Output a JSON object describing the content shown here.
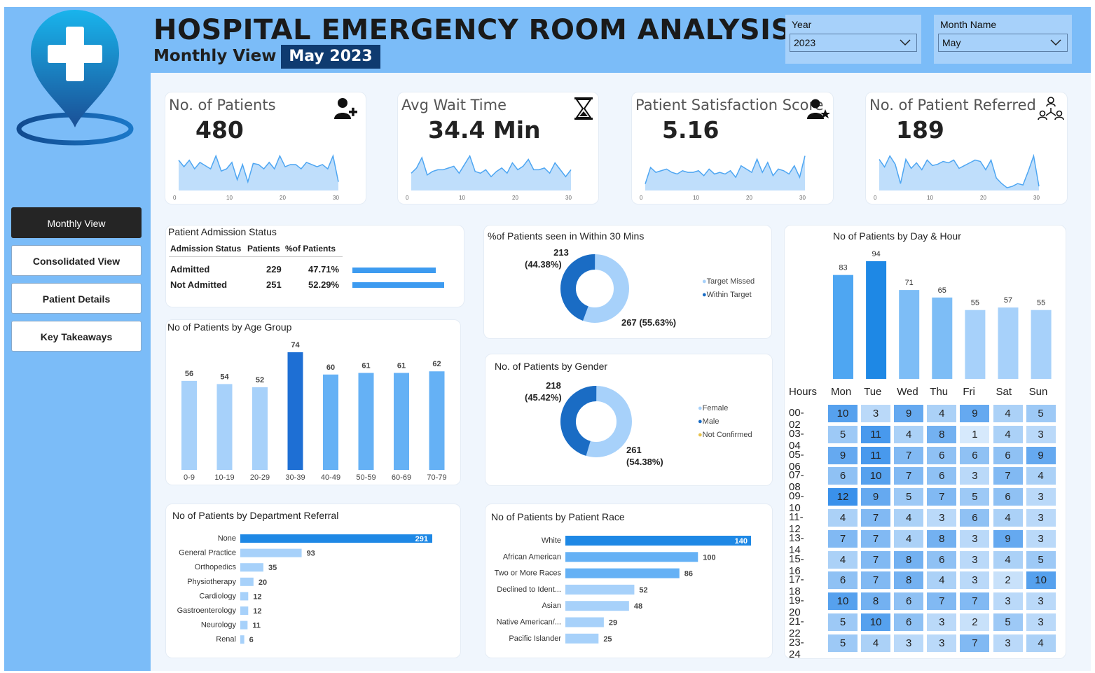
{
  "header": {
    "title": "HOSPITAL EMERGENCY ROOM ANALYSIS",
    "subtitle": "Monthly View",
    "period": "May 2023"
  },
  "filters": {
    "year": {
      "label": "Year",
      "value": "2023"
    },
    "month": {
      "label": "Month Name",
      "value": "May"
    }
  },
  "nav": {
    "items": [
      {
        "label": "Monthly View",
        "active": true
      },
      {
        "label": "Consolidated View",
        "active": false
      },
      {
        "label": "Patient Details",
        "active": false
      },
      {
        "label": "Key Takeaways",
        "active": false
      }
    ]
  },
  "colors": {
    "dark_blue": "#1e6fd4",
    "mid_blue": "#65b1f5",
    "light_blue": "#a7d1fa",
    "navy": "#0f3b70",
    "sidebar": "#7bbcf8"
  },
  "kpis": [
    {
      "title": "No. of Patients",
      "value": "480",
      "icon": "add-user-icon",
      "spark": [
        28,
        22,
        28,
        20,
        26,
        23,
        20,
        32,
        18,
        20,
        26,
        10,
        24,
        8,
        25,
        24,
        20,
        26,
        20,
        32,
        22,
        24,
        24,
        20,
        26,
        24,
        22,
        24,
        20,
        32,
        8
      ]
    },
    {
      "title": "Avg Wait Time",
      "value": "34.4 Min",
      "icon": "hourglass-icon",
      "spark": [
        20,
        26,
        38,
        18,
        22,
        24,
        24,
        26,
        28,
        20,
        30,
        40,
        22,
        20,
        24,
        16,
        22,
        26,
        20,
        32,
        24,
        28,
        36,
        24,
        24,
        26,
        20,
        32,
        24,
        16,
        24
      ]
    },
    {
      "title": "Patient Satisfaction  Score",
      "value": "5.16",
      "icon": "user-star-icon",
      "spark": [
        8,
        28,
        22,
        24,
        26,
        22,
        20,
        24,
        22,
        22,
        24,
        18,
        26,
        20,
        22,
        20,
        24,
        16,
        30,
        26,
        22,
        38,
        22,
        34,
        18,
        26,
        24,
        20,
        30,
        16,
        42
      ]
    },
    {
      "title": "No. of Patient Referred",
      "value": "189",
      "icon": "network-icon",
      "spark": [
        45,
        34,
        50,
        38,
        10,
        45,
        32,
        40,
        30,
        44,
        36,
        38,
        42,
        40,
        44,
        32,
        36,
        40,
        44,
        42,
        30,
        44,
        18,
        10,
        4,
        6,
        10,
        8,
        28,
        50,
        6
      ]
    }
  ],
  "spark_axis": [
    "0",
    "10",
    "20",
    "30"
  ],
  "admission": {
    "title": "Patient Admission Status",
    "headers": [
      "Admission Status",
      "Patients",
      "%of Patients"
    ],
    "rows": [
      {
        "status": "Admitted",
        "patients": "229",
        "pct": "47.71%",
        "fraction": 0.4771
      },
      {
        "status": "Not Admitted",
        "patients": "251",
        "pct": "52.29%",
        "fraction": 0.5229
      }
    ]
  },
  "wait30": {
    "title": "%of Patients seen in Within 30 Mins",
    "legend": [
      "Target Missed",
      "Within Target"
    ],
    "label_big": {
      "count": "267",
      "pct": "(55.63%)"
    },
    "label_small": {
      "count": "213",
      "pct": "(44.38%)"
    }
  },
  "gender": {
    "title": "No. of Patients by Gender",
    "legend": [
      "Female",
      "Male",
      "Not Confirmed"
    ],
    "label_big": {
      "count": "261",
      "pct": "(54.38%)"
    },
    "label_small": {
      "count": "218",
      "pct": "(45.42%)"
    }
  },
  "day_hour": {
    "title": "No of Patients by Day & Hour",
    "hours_label": "Hours",
    "days": [
      "Mon",
      "Tue",
      "Wed",
      "Thu",
      "Fri",
      "Sat",
      "Sun"
    ],
    "totals": [
      83,
      94,
      71,
      65,
      55,
      57,
      55
    ],
    "hours": [
      "00-02",
      "03-04",
      "05-06",
      "07-08",
      "09-10",
      "11-12",
      "13-14",
      "15-16",
      "17-18",
      "19-20",
      "21-22",
      "23-24"
    ],
    "matrix": [
      [
        10,
        3,
        9,
        4,
        9,
        4,
        5
      ],
      [
        5,
        11,
        4,
        8,
        1,
        4,
        3
      ],
      [
        9,
        11,
        7,
        6,
        6,
        6,
        9
      ],
      [
        6,
        10,
        7,
        6,
        3,
        7,
        4
      ],
      [
        12,
        9,
        5,
        7,
        5,
        6,
        3
      ],
      [
        4,
        7,
        4,
        3,
        6,
        4,
        3
      ],
      [
        7,
        7,
        4,
        8,
        3,
        9,
        3
      ],
      [
        4,
        7,
        8,
        6,
        3,
        4,
        5
      ],
      [
        6,
        7,
        8,
        4,
        3,
        2,
        10
      ],
      [
        10,
        8,
        6,
        7,
        7,
        3,
        3
      ],
      [
        5,
        10,
        6,
        3,
        2,
        5,
        3
      ],
      [
        5,
        4,
        3,
        3,
        7,
        3,
        4
      ]
    ]
  },
  "chart_data": [
    {
      "type": "bar",
      "title": "No of Patients by Age Group",
      "categories": [
        "0-9",
        "10-19",
        "20-29",
        "30-39",
        "40-49",
        "50-59",
        "60-69",
        "70-79"
      ],
      "values": [
        56,
        54,
        52,
        74,
        60,
        61,
        61,
        62
      ]
    },
    {
      "type": "bar",
      "orientation": "horizontal",
      "title": "No of Patients by Department Referral",
      "categories": [
        "None",
        "General Practice",
        "Orthopedics",
        "Physiotherapy",
        "Cardiology",
        "Gastroenterology",
        "Neurology",
        "Renal"
      ],
      "values": [
        291,
        93,
        35,
        20,
        12,
        12,
        11,
        6
      ]
    },
    {
      "type": "bar",
      "orientation": "horizontal",
      "title": "No of Patients by Patient Race",
      "categories": [
        "White",
        "African American",
        "Two or More Races",
        "Declined to Ident...",
        "Asian",
        "Native American/...",
        "Pacific Islander"
      ],
      "values": [
        140,
        100,
        86,
        52,
        48,
        29,
        25
      ]
    }
  ]
}
